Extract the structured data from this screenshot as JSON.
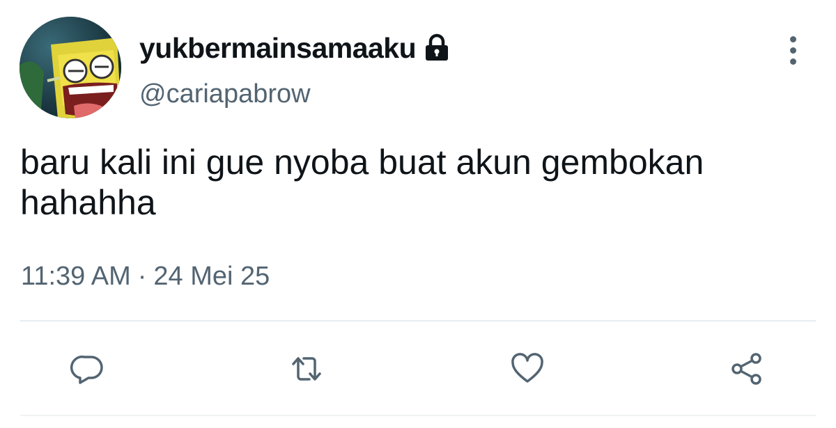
{
  "tweet": {
    "display_name": "yukbermainsamaaku",
    "handle": "@cariapabrow",
    "text": "baru kali ini gue nyoba buat akun gembokan hahahha",
    "time": "11:39 AM",
    "separator": "·",
    "date": "24 Mei 25"
  },
  "icons": {
    "lock": "lock-icon",
    "more": "more-vertical-icon",
    "reply": "reply-icon",
    "retweet": "retweet-icon",
    "like": "heart-icon",
    "share": "share-icon"
  },
  "colors": {
    "text_primary": "#0f1419",
    "text_secondary": "#536471",
    "icon": "#536471",
    "divider": "#e6ecf0"
  }
}
